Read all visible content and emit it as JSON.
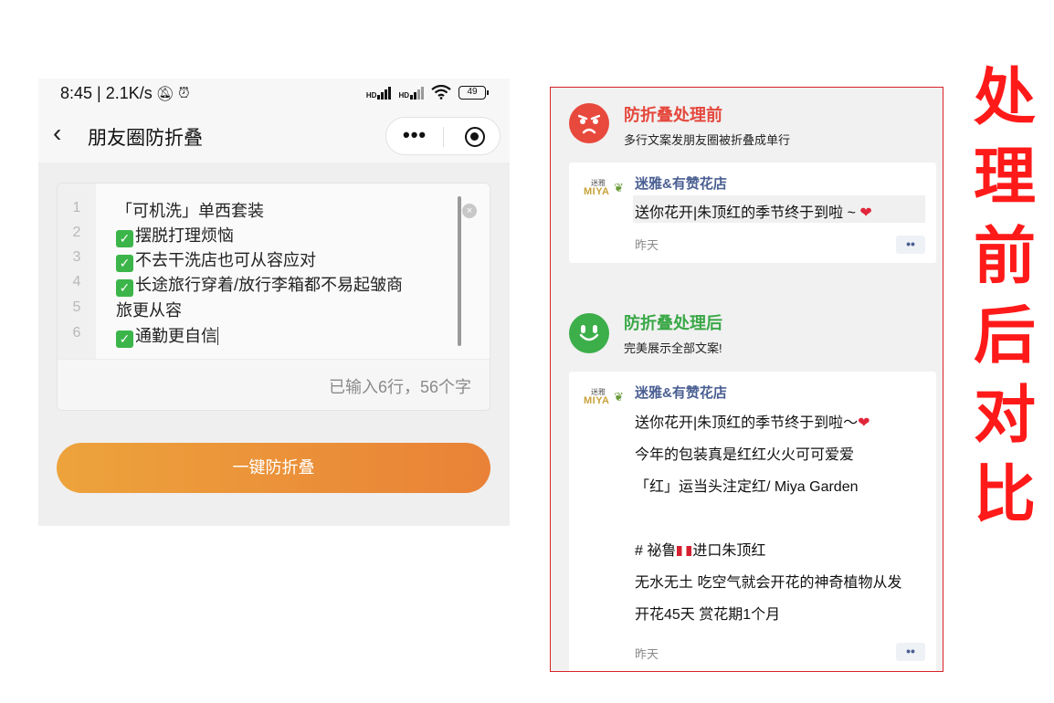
{
  "status_bar": {
    "time_speed": "8:45 | 2.1K/s",
    "hd1": "HD",
    "hd2": "HD",
    "battery": "49"
  },
  "nav": {
    "back_glyph": "‹",
    "title": "朋友圈防折叠",
    "more_glyph": "•••"
  },
  "editor": {
    "line_numbers": [
      "1",
      "2",
      "3",
      "4",
      "5",
      "6"
    ],
    "lines": [
      "「可机洗」单西套装",
      "摆脱打理烦恼",
      "不去干洗店也可从容应对",
      "长途旅行穿着/放行李箱都不易起皱商",
      "旅更从容",
      "通勤更自信"
    ],
    "check_glyph": "✓",
    "clear_glyph": "×",
    "count_text": "已输入6行，56个字"
  },
  "action": {
    "button_label": "一键防折叠"
  },
  "before": {
    "title": "防折叠处理前",
    "subtitle": "多行文案发朋友圈被折叠成单行",
    "logo_top": "迷雅",
    "logo_main": "MIYA",
    "shop": "迷雅&有赞花店",
    "text": "送你花开|朱顶红的季节终于到啦 ~ ",
    "heart": "❤",
    "time": "昨天",
    "dots": "••"
  },
  "after": {
    "title": "防折叠处理后",
    "subtitle": "完美展示全部文案!",
    "logo_top": "迷雅",
    "logo_main": "MIYA",
    "shop": "迷雅&有赞花店",
    "line1": "送你花开|朱顶红的季节终于到啦～",
    "heart": "❤",
    "line2": "今年的包装真是红红火火可可爱爱",
    "line3": "「红」运当头注定红/ Miya Garden",
    "line4a": "# 祕鲁",
    "line4b": "进口朱顶红",
    "line5": "无水无土 吃空气就会开花的神奇植物从发",
    "line6": "开花45天 赏花期1个月",
    "time": "昨天",
    "dots": "••"
  },
  "label": {
    "chars": [
      "处",
      "理",
      "前",
      "后",
      "对",
      "比"
    ]
  },
  "colors": {
    "accent_orange_start": "#eda33c",
    "accent_orange_end": "#e98237",
    "red": "#e5483d",
    "green": "#3aa847",
    "link_blue": "#4a5f92",
    "label_red": "#ff1a1a"
  }
}
